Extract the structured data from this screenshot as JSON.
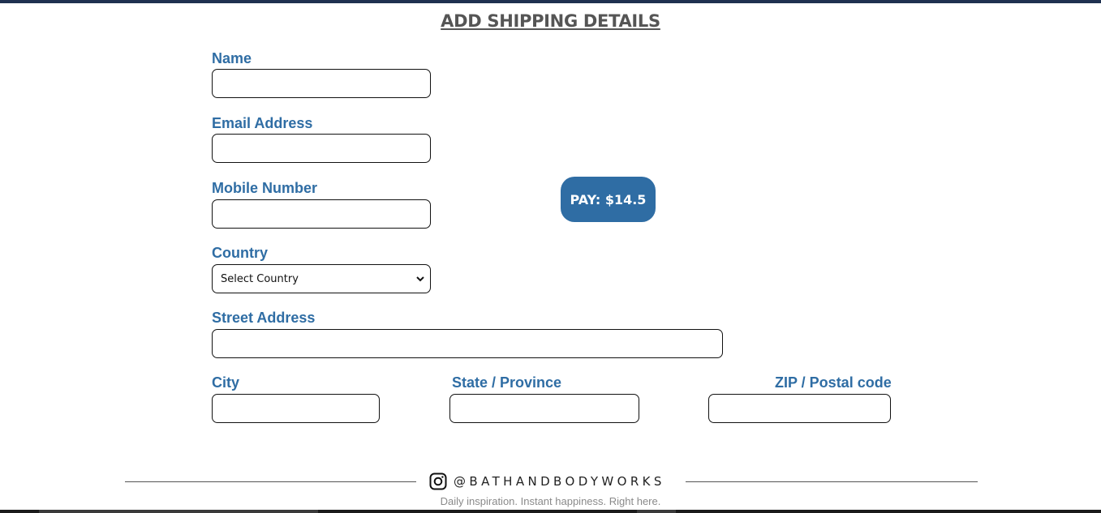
{
  "page": {
    "title": "ADD SHIPPING DETAILS"
  },
  "form": {
    "name_label": "Name",
    "name_value": "",
    "email_label": "Email Address",
    "email_value": "",
    "mobile_label": "Mobile Number",
    "mobile_value": "",
    "country_label": "Country",
    "country_selected": "Select Country",
    "street_label": "Street Address",
    "street_value": "",
    "city_label": "City",
    "city_value": "",
    "state_label": "State / Province",
    "state_value": "",
    "zip_label": "ZIP / Postal code",
    "zip_value": ""
  },
  "pay": {
    "label": "PAY: $14.5"
  },
  "footer": {
    "handle": "@BATHANDBODYWORKS",
    "tagline": "Daily inspiration. Instant happiness. Right here.",
    "icon": "instagram-icon"
  },
  "colors": {
    "label": "#2f6da4",
    "pay_button": "#2f6da4",
    "title": "#555555",
    "top_bar": "#1f3150"
  }
}
